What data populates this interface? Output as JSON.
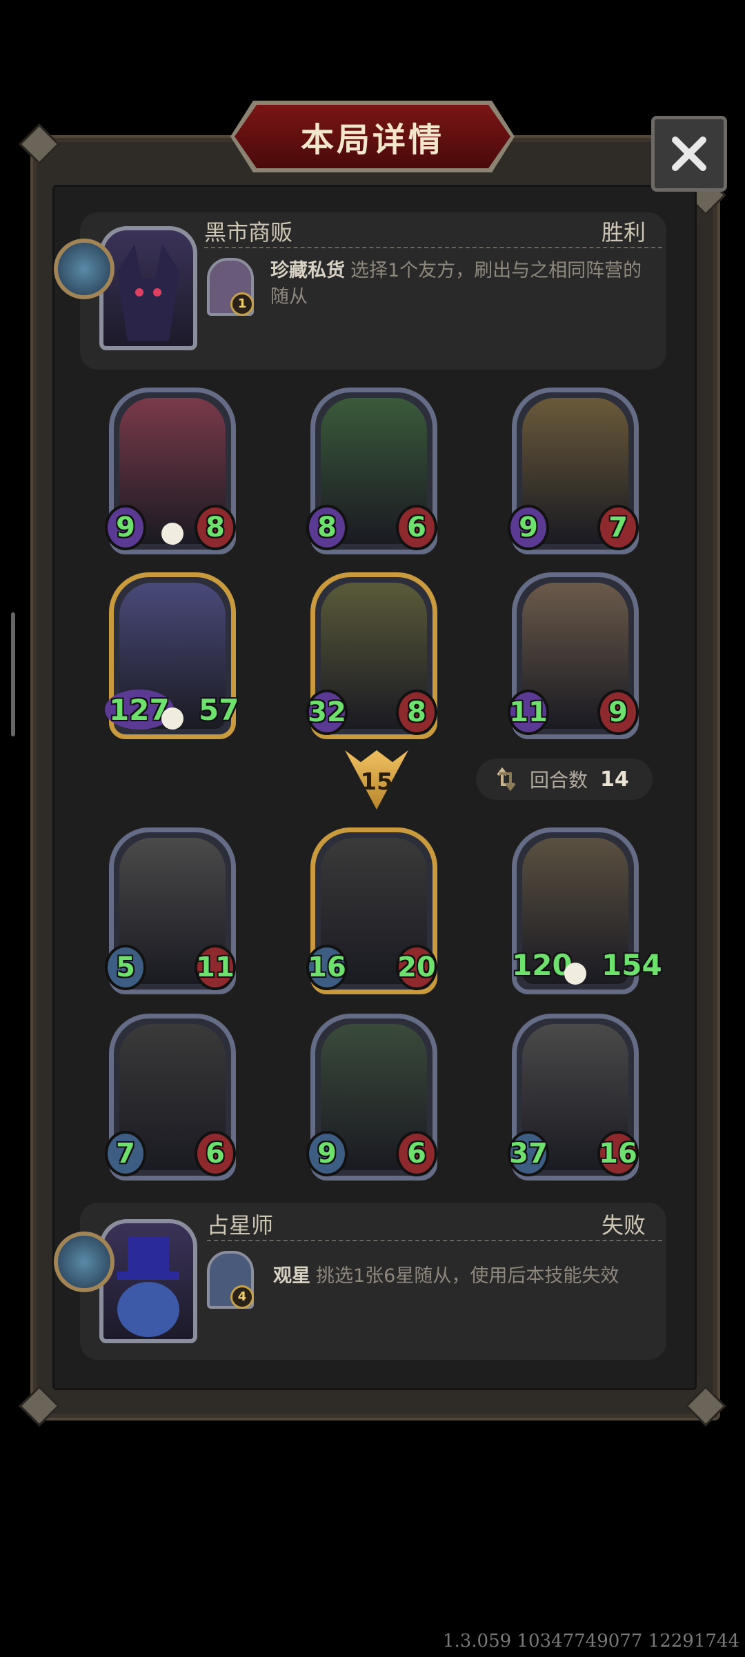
{
  "dialog": {
    "title": "本局详情",
    "close_icon": "close-x-icon"
  },
  "player_top": {
    "name": "黑市商贩",
    "result": "胜利",
    "skill": {
      "name": "珍藏私货",
      "description": "选择1个友方，刷出与之相同阵营的随从",
      "cost": "1"
    }
  },
  "player_bottom": {
    "name": "占星师",
    "result": "失败",
    "skill": {
      "name": "观星",
      "description": "挑选1张6星随从，使用后本技能失效",
      "cost": "4"
    }
  },
  "top_board": [
    {
      "attack": "9",
      "health": "8",
      "frame": "silver",
      "atk_type": "purple",
      "skull": true
    },
    {
      "attack": "8",
      "health": "6",
      "frame": "silver",
      "atk_type": "purple",
      "skull": false
    },
    {
      "attack": "9",
      "health": "7",
      "frame": "silver",
      "atk_type": "purple",
      "skull": false
    },
    {
      "attack": "127",
      "health": "57",
      "frame": "gold",
      "atk_type": "purple",
      "skull": true
    },
    {
      "attack": "32",
      "health": "8",
      "frame": "gold",
      "atk_type": "purple",
      "skull": false
    },
    {
      "attack": "11",
      "health": "9",
      "frame": "silver",
      "atk_type": "purple",
      "skull": false
    }
  ],
  "bottom_board": [
    {
      "attack": "5",
      "health": "11",
      "frame": "silver",
      "skull": false
    },
    {
      "attack": "16",
      "health": "20",
      "frame": "gold",
      "skull": false
    },
    {
      "attack": "120",
      "health": "154",
      "frame": "silver",
      "skull": true
    },
    {
      "attack": "7",
      "health": "6",
      "frame": "silver",
      "skull": false
    },
    {
      "attack": "9",
      "health": "6",
      "frame": "silver",
      "skull": false
    },
    {
      "attack": "37",
      "health": "16",
      "frame": "silver",
      "skull": false
    }
  ],
  "tier": "15",
  "round": {
    "label": "回合数",
    "value": "14",
    "icon": "refresh-arrows-icon"
  },
  "version_text": "1.3.059 10347749077 12291744",
  "colors": {
    "title_red": "#7a1515",
    "stat_green": "#6ee06e",
    "gold_frame": "#c99a3e",
    "silver_frame": "#646c86"
  }
}
